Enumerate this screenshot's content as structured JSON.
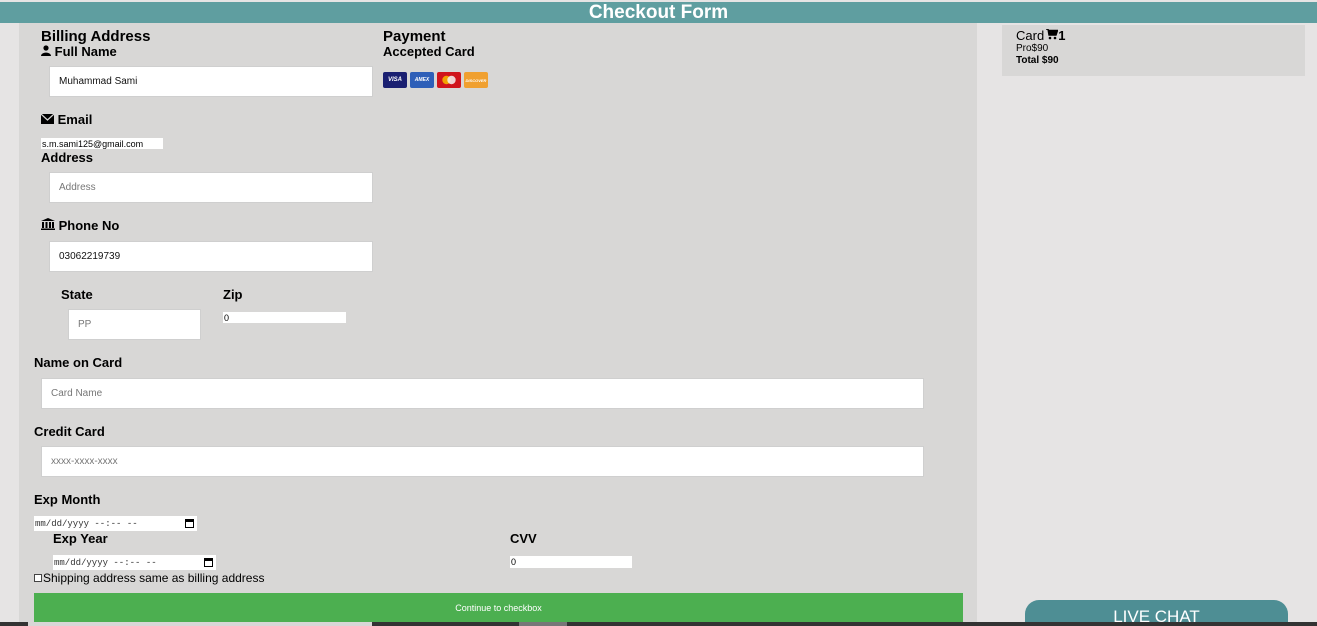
{
  "header": {
    "title": "Checkout Form"
  },
  "billing": {
    "heading": "Billing Address",
    "full_name_label": "Full Name",
    "full_name_value": "Muhammad Sami",
    "email_label": "Email",
    "email_value": "s.m.sami125@gmail.com",
    "address_label": "Address",
    "address_placeholder": "Address",
    "phone_label": "Phone No",
    "phone_value": "03062219739",
    "state_label": "State",
    "state_placeholder": "PP",
    "zip_label": "Zip",
    "zip_value": "0"
  },
  "payment": {
    "heading": "Payment",
    "accepted_label": "Accepted Card",
    "cards": [
      "VISA",
      "AMEX",
      "MC",
      "DISCOVER"
    ],
    "name_on_card_label": "Name on Card",
    "name_on_card_placeholder": "Card Name",
    "credit_card_label": "Credit Card",
    "credit_card_placeholder": "xxxx-xxxx-xxxx",
    "exp_month_label": "Exp Month",
    "exp_month_value": "mm/dd/yyyy --:-- --",
    "exp_year_label": "Exp Year",
    "exp_year_value": "mm/dd/yyyy --:-- --",
    "cvv_label": "CVV",
    "cvv_value": "0"
  },
  "shipping_checkbox_label": "Shipping address same as billing address",
  "submit_label": "Continue to checkbox",
  "cart": {
    "title": "Card",
    "count": "1",
    "item": "Pro$90",
    "total": "Total $90"
  },
  "live_chat_label": "LIVE CHAT",
  "colors": {
    "header": "#5f9ea0",
    "button": "#4caf50",
    "chat": "#4e8e94"
  }
}
